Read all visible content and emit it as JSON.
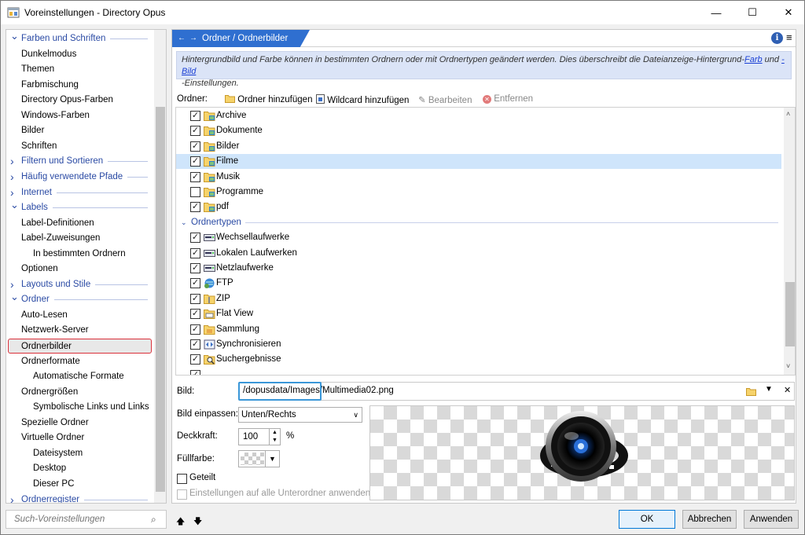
{
  "window": {
    "title": "Voreinstellungen - Directory Opus"
  },
  "titlebar": {
    "min": "—",
    "max": "☐",
    "close": "✕"
  },
  "tree": {
    "items": [
      {
        "label": "Farben und Schriften",
        "level": 1,
        "expanded": true
      },
      {
        "label": "Dunkelmodus",
        "level": 2
      },
      {
        "label": "Themen",
        "level": 2
      },
      {
        "label": "Farbmischung",
        "level": 2
      },
      {
        "label": "Directory Opus-Farben",
        "level": 2
      },
      {
        "label": "Windows-Farben",
        "level": 2
      },
      {
        "label": "Bilder",
        "level": 2
      },
      {
        "label": "Schriften",
        "level": 2
      },
      {
        "label": "Filtern und Sortieren",
        "level": 1,
        "expanded": false
      },
      {
        "label": "Häufig verwendete Pfade",
        "level": 1,
        "expanded": false
      },
      {
        "label": "Internet",
        "level": 1,
        "expanded": false
      },
      {
        "label": "Labels",
        "level": 1,
        "expanded": true
      },
      {
        "label": "Label-Definitionen",
        "level": 2
      },
      {
        "label": "Label-Zuweisungen",
        "level": 2
      },
      {
        "label": "In bestimmten Ordnern",
        "level": 3
      },
      {
        "label": "Optionen",
        "level": 2
      },
      {
        "label": "Layouts und Stile",
        "level": 1,
        "expanded": false
      },
      {
        "label": "Ordner",
        "level": 1,
        "expanded": true
      },
      {
        "label": "Auto-Lesen",
        "level": 2
      },
      {
        "label": "Netzwerk-Server",
        "level": 2
      },
      {
        "label": "Ordnerbilder",
        "level": 2,
        "selected": true
      },
      {
        "label": "Ordnerformate",
        "level": 2
      },
      {
        "label": "Automatische Formate",
        "level": 3
      },
      {
        "label": "Ordnergrößen",
        "level": 2
      },
      {
        "label": "Symbolische Links und Links",
        "level": 3
      },
      {
        "label": "Spezielle Ordner",
        "level": 2
      },
      {
        "label": "Virtuelle Ordner",
        "level": 2
      },
      {
        "label": "Dateisystem",
        "level": 3
      },
      {
        "label": "Desktop",
        "level": 3
      },
      {
        "label": "Dieser PC",
        "level": 3
      },
      {
        "label": "Ordnerregister",
        "level": 1,
        "expanded": false
      }
    ]
  },
  "search": {
    "placeholder": "Such-Voreinstellungen"
  },
  "breadcrumb": {
    "label": "Ordner / Ordnerbilder"
  },
  "info": {
    "text_before": "Hintergrundbild und Farbe können in bestimmten Ordnern oder mit Ordnertypen geändert werden. Dies überschreibt die Dateianzeige-Hintergrund-",
    "link1": "Farb",
    "middle": " und ",
    "link2": "-Bild",
    "text_after": "-Einstellungen."
  },
  "toolbar": {
    "label": "Ordner:",
    "add_folder": "Ordner hinzufügen",
    "add_wildcard": "Wildcard hinzufügen",
    "edit": "Bearbeiten",
    "remove": "Entfernen"
  },
  "folders": [
    {
      "label": "Archive",
      "checked": true
    },
    {
      "label": "Dokumente",
      "checked": true
    },
    {
      "label": "Bilder",
      "checked": true
    },
    {
      "label": "Filme",
      "checked": true,
      "selected": true
    },
    {
      "label": "Musik",
      "checked": true
    },
    {
      "label": "Programme",
      "checked": false
    },
    {
      "label": "pdf",
      "checked": true
    }
  ],
  "group": {
    "label": "Ordnertypen"
  },
  "folder_types": [
    {
      "label": "Wechsellaufwerke",
      "checked": true,
      "icon": "removable-drive-icon"
    },
    {
      "label": "Lokalen Laufwerken",
      "checked": true,
      "icon": "local-drive-icon"
    },
    {
      "label": "Netzlaufwerke",
      "checked": true,
      "icon": "network-drive-icon"
    },
    {
      "label": "FTP",
      "checked": true,
      "icon": "ftp-icon"
    },
    {
      "label": "ZIP",
      "checked": true,
      "icon": "zip-icon"
    },
    {
      "label": "Flat View",
      "checked": true,
      "icon": "flat-view-icon"
    },
    {
      "label": "Sammlung",
      "checked": true,
      "icon": "collection-icon"
    },
    {
      "label": "Synchronisieren",
      "checked": true,
      "icon": "sync-icon"
    },
    {
      "label": "Suchergebnisse",
      "checked": true,
      "icon": "search-results-icon"
    }
  ],
  "bild": {
    "label": "Bild:",
    "value": "/dopusdata/Images/Multimedia02.png"
  },
  "fit": {
    "label": "Bild einpassen:",
    "value": "Unten/Rechts"
  },
  "opacity": {
    "label": "Deckkraft:",
    "value": "100",
    "unit": "%"
  },
  "fill": {
    "label": "Füllfarbe:"
  },
  "tiled": {
    "label": "Geteilt"
  },
  "apply_sub": {
    "label": "Einstellungen auf alle Unterordner anwenden"
  },
  "buttons": {
    "ok": "OK",
    "cancel": "Abbrechen",
    "apply": "Anwenden"
  },
  "nav": {
    "up": "🡅",
    "down": "🡇"
  },
  "colors": {
    "accent": "#2f6fd0",
    "selection_border": "#d9303a",
    "highlight": "#3a97d8"
  }
}
